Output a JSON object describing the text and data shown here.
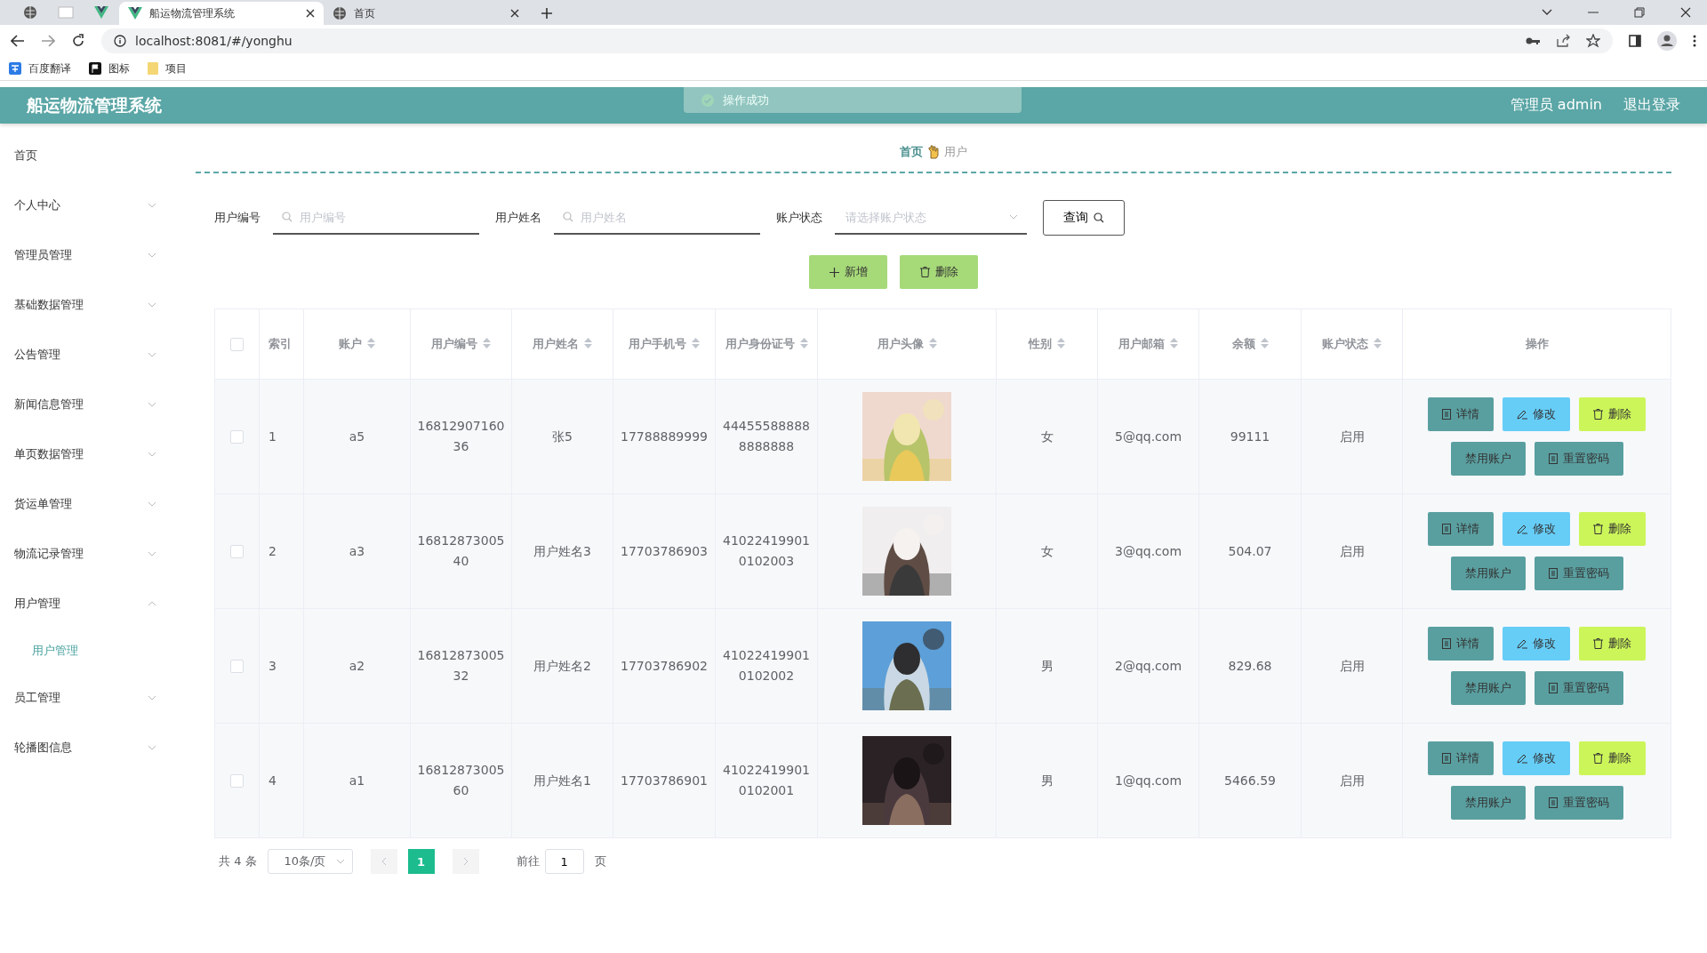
{
  "browser": {
    "tabs": [
      {
        "title": "船运物流管理系统",
        "kind": "vue",
        "selected": true
      },
      {
        "title": "首页",
        "kind": "globe",
        "selected": false
      }
    ],
    "url": "localhost:8081/#/yonghu",
    "bookmarks": [
      {
        "label": "百度翻译",
        "kind": "translate"
      },
      {
        "label": "图标",
        "kind": "flag"
      },
      {
        "label": "项目",
        "kind": "folder"
      }
    ]
  },
  "header": {
    "title": "船运物流管理系统",
    "user": "管理员 admin",
    "logout": "退出登录",
    "toast": "操作成功"
  },
  "sidebar": {
    "items": [
      {
        "label": "首页",
        "kind": "link"
      },
      {
        "label": "个人中心",
        "kind": "submenu",
        "expanded": false
      },
      {
        "label": "管理员管理",
        "kind": "submenu",
        "expanded": false
      },
      {
        "label": "基础数据管理",
        "kind": "submenu",
        "expanded": false
      },
      {
        "label": "公告管理",
        "kind": "submenu",
        "expanded": false
      },
      {
        "label": "新闻信息管理",
        "kind": "submenu",
        "expanded": false
      },
      {
        "label": "单页数据管理",
        "kind": "submenu",
        "expanded": false
      },
      {
        "label": "货运单管理",
        "kind": "submenu",
        "expanded": false
      },
      {
        "label": "物流记录管理",
        "kind": "submenu",
        "expanded": false
      },
      {
        "label": "用户管理",
        "kind": "submenu",
        "expanded": true,
        "children": [
          {
            "label": "用户管理",
            "selected": true
          }
        ]
      },
      {
        "label": "员工管理",
        "kind": "submenu",
        "expanded": false
      },
      {
        "label": "轮播图信息",
        "kind": "submenu",
        "expanded": false
      }
    ]
  },
  "breadcrumb": [
    "首页",
    "用户"
  ],
  "filters": [
    {
      "label": "用户编号",
      "placeholder": "用户编号",
      "kind": "text"
    },
    {
      "label": "用户姓名",
      "placeholder": "用户姓名",
      "kind": "text"
    },
    {
      "label": "账户状态",
      "placeholder": "请选择账户状态",
      "kind": "select"
    }
  ],
  "search_button": "查询",
  "actions": [
    {
      "label": "新增",
      "kind": "add"
    },
    {
      "label": "删除",
      "kind": "delete"
    }
  ],
  "table": {
    "all_selected": false,
    "columns": [
      {
        "kind": "check"
      },
      {
        "label": "索引",
        "sortable": false
      },
      {
        "label": "账户",
        "sortable": true
      },
      {
        "label": "用户编号",
        "sortable": true
      },
      {
        "label": "用户姓名",
        "sortable": true
      },
      {
        "label": "用户手机号",
        "sortable": true
      },
      {
        "label": "用户身份证号",
        "sortable": true
      },
      {
        "label": "用户头像",
        "sortable": true
      },
      {
        "label": "性别",
        "sortable": true
      },
      {
        "label": "用户邮箱",
        "sortable": true
      },
      {
        "label": "余额",
        "sortable": true
      },
      {
        "label": "账户状态",
        "sortable": true
      },
      {
        "label": "操作",
        "sortable": false
      }
    ],
    "rows": [
      {
        "selected": false,
        "index": "1",
        "account": "a5",
        "number": "1681290716036",
        "name": "张5",
        "phone": "17788889999",
        "idcard": "444555888888888888",
        "gender": "女",
        "email": "5@qq.com",
        "balance": "99111",
        "status": "启用",
        "actions": [
          {
            "label": "详情",
            "kind": "detail"
          },
          {
            "label": "修改",
            "kind": "edit"
          },
          {
            "label": "删除",
            "kind": "delete"
          },
          {
            "label": "禁用账户",
            "kind": "disable"
          },
          {
            "label": "重置密码",
            "kind": "reset"
          }
        ]
      },
      {
        "selected": false,
        "index": "2",
        "account": "a3",
        "number": "1681287300540",
        "name": "用户姓名3",
        "phone": "17703786903",
        "idcard": "410224199010102003",
        "gender": "女",
        "email": "3@qq.com",
        "balance": "504.07",
        "status": "启用",
        "actions": [
          {
            "label": "详情",
            "kind": "detail"
          },
          {
            "label": "修改",
            "kind": "edit"
          },
          {
            "label": "删除",
            "kind": "delete"
          },
          {
            "label": "禁用账户",
            "kind": "disable"
          },
          {
            "label": "重置密码",
            "kind": "reset"
          }
        ]
      },
      {
        "selected": false,
        "index": "3",
        "account": "a2",
        "number": "1681287300532",
        "name": "用户姓名2",
        "phone": "17703786902",
        "idcard": "410224199010102002",
        "gender": "男",
        "email": "2@qq.com",
        "balance": "829.68",
        "status": "启用",
        "actions": [
          {
            "label": "详情",
            "kind": "detail"
          },
          {
            "label": "修改",
            "kind": "edit"
          },
          {
            "label": "删除",
            "kind": "delete"
          },
          {
            "label": "禁用账户",
            "kind": "disable"
          },
          {
            "label": "重置密码",
            "kind": "reset"
          }
        ]
      },
      {
        "selected": false,
        "index": "4",
        "account": "a1",
        "number": "1681287300560",
        "name": "用户姓名1",
        "phone": "17703786901",
        "idcard": "410224199010102001",
        "gender": "男",
        "email": "1@qq.com",
        "balance": "5466.59",
        "status": "启用",
        "actions": [
          {
            "label": "详情",
            "kind": "detail"
          },
          {
            "label": "修改",
            "kind": "edit"
          },
          {
            "label": "删除",
            "kind": "delete"
          },
          {
            "label": "禁用账户",
            "kind": "disable"
          },
          {
            "label": "重置密码",
            "kind": "reset"
          }
        ]
      }
    ]
  },
  "pagination": {
    "total": "共 4 条",
    "page_size": "10条/页",
    "pages": [
      {
        "label": "1",
        "selected": true
      }
    ],
    "goto_label": "前往",
    "goto_value": "1",
    "goto_suffix": "页"
  }
}
